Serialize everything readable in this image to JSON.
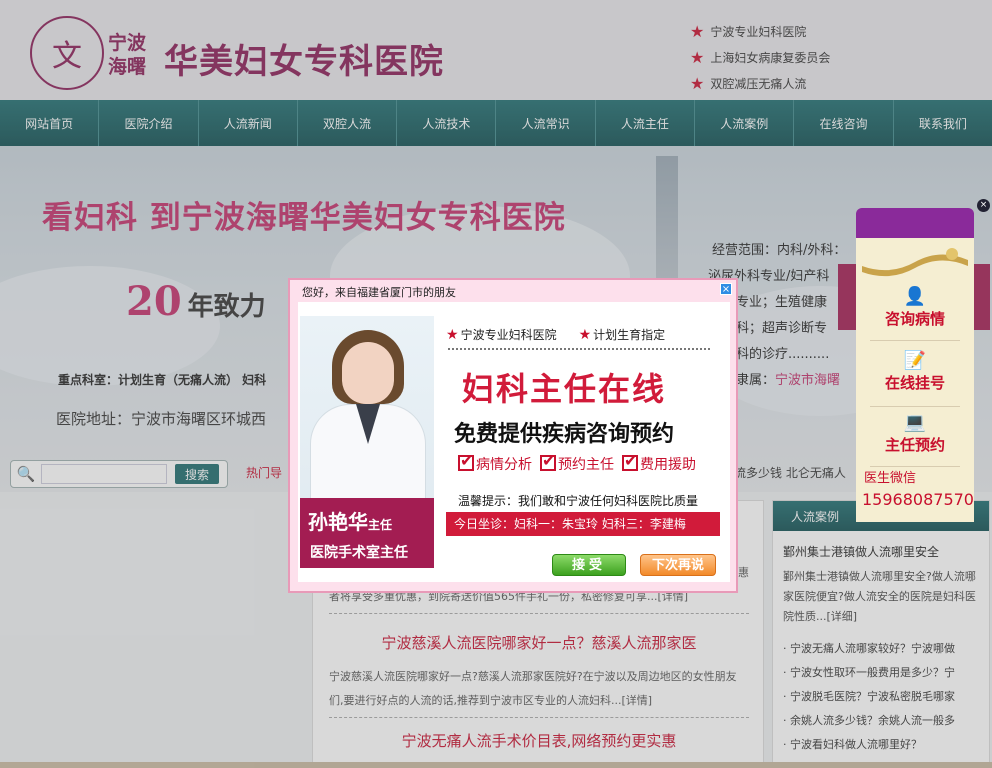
{
  "header": {
    "logo_place_line1": "宁波",
    "logo_place_line2": "海曙",
    "logo_name": "华美妇女专科医院",
    "tags": [
      "宁波专业妇科医院",
      "上海妇女病康复委员会",
      "双腔减压无痛人流"
    ]
  },
  "nav": [
    "网站首页",
    "医院介绍",
    "人流新闻",
    "双腔人流",
    "人流技术",
    "人流常识",
    "人流主任",
    "人流案例",
    "在线咨询",
    "联系我们"
  ],
  "banner": {
    "title": "看妇科  到宁波海曙华美妇女专科医院",
    "years_num": "20",
    "years_text": "年致力",
    "key_depts": "重点科室：计划生育（无痛人流） 妇科",
    "address": "医院地址：宁波市海曙区环城西",
    "scope": [
      "经营范围：内科/外科：",
      "泌尿外科专业/妇产科",
      "专业；生殖健康",
      "科；超声诊断专",
      "科的诊疗..........",
      "隶属：宁波市海曙"
    ],
    "scope_link": "宁波市海曙"
  },
  "search": {
    "placeholder": "",
    "button": "搜索",
    "hot_label": "热门导",
    "hot_links": "流多少钱   北仑无痛人"
  },
  "news": [
    {
      "title": "",
      "text": "者将享受多重优惠，到院寄送价值565件手礼一份，私密修复可享...[详情]",
      "prefix": "惠"
    },
    {
      "title": "宁波慈溪人流医院哪家好一点？慈溪人流那家医",
      "text": "宁波慈溪人流医院哪家好一点?慈溪人流那家医院好?在宁波以及周边地区的女性朋友们,要进行好点的人流的话,推荐到宁波市区专业的人流妇科...[详情]"
    },
    {
      "title": "宁波无痛人流手术价目表,网络预约更实惠",
      "text": ""
    }
  ],
  "right_col": {
    "head": "人流案例",
    "title": "鄞州集士港镇做人流哪里安全",
    "desc": "鄞州集士港镇做人流哪里安全?做人流哪家医院便宜?做人流安全的医院是妇科医院性质...[详细]",
    "list": [
      "宁波无痛人流哪家较好？宁波哪做",
      "宁波女性取环一般费用是多少？宁",
      "宁波脱毛医院？宁波私密脱毛哪家",
      "余姚人流多少钱？余姚人流一般多",
      "宁波看妇科做人流哪里好？"
    ]
  },
  "popup": {
    "title": "您好，来自福建省厦门市的朋友",
    "close": "×",
    "doctor_name": "孙艳华",
    "doctor_role_suffix": "主任",
    "doctor_title": "医院手术室主任",
    "tag1": "宁波专业妇科医院",
    "tag2": "计划生育指定",
    "headline": "妇科主任在线",
    "subheadline": "免费提供疾病咨询预约",
    "checks": [
      "病情分析",
      "预约主任",
      "费用援助"
    ],
    "tip": "温馨提示：我们敢和宁波任何妇科医院比质量",
    "today": "今日坐诊：妇科一：朱宝玲  妇科三：李建梅",
    "accept": "接受",
    "later": "下次再说"
  },
  "side_float": {
    "close": "×",
    "items": [
      "咨询病情",
      "在线挂号",
      "主任预约"
    ],
    "wechat_label": "医生微信",
    "phone": "15968087570"
  },
  "colors": {
    "brand": "#8a1c57",
    "nav": "#1e6d70",
    "accent": "#c8102e"
  }
}
